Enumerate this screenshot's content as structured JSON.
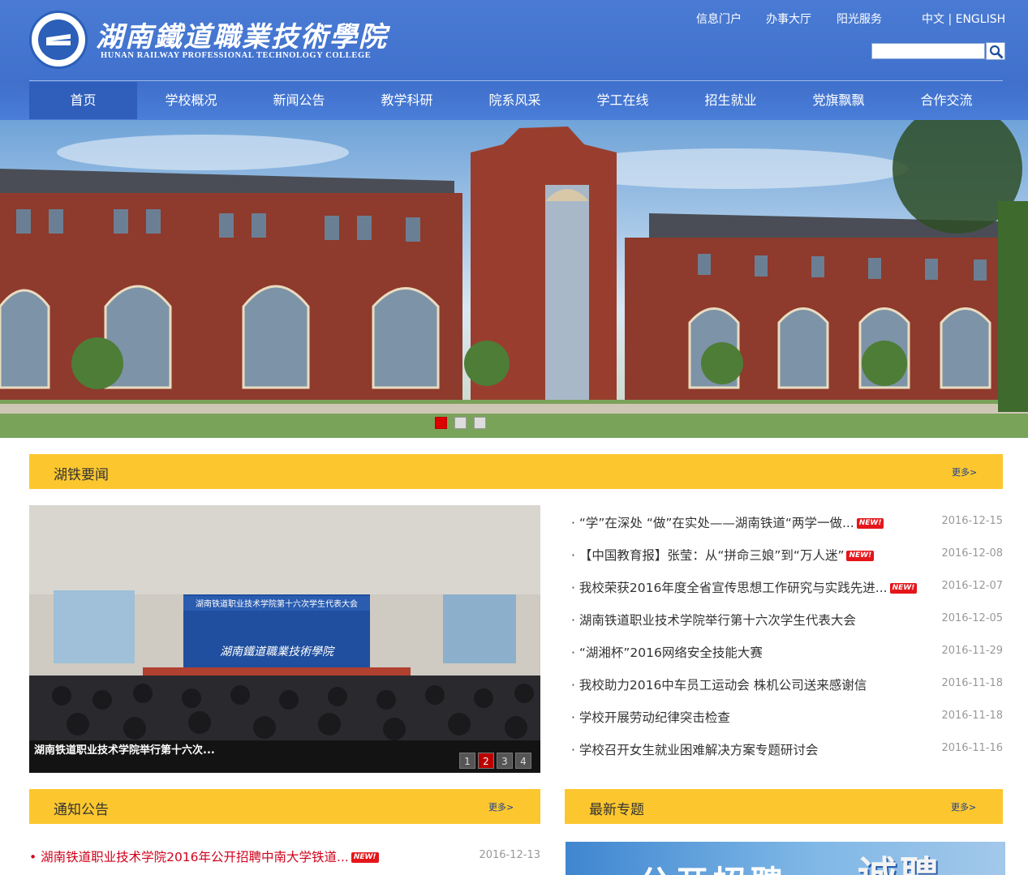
{
  "brand": {
    "name_cn": "湖南鐵道職業技術學院",
    "name_en": "HUNAN RAILWAY PROFESSIONAL TECHNOLOGY COLLEGE"
  },
  "toplinks": {
    "portal": "信息门户",
    "hall": "办事大厅",
    "sunshine": "阳光服务",
    "lang": "中文 | ENGLISH"
  },
  "search": {
    "placeholder": ""
  },
  "nav": [
    "首页",
    "学校概况",
    "新闻公告",
    "教学科研",
    "院系风采",
    "学工在线",
    "招生就业",
    "党旗飘飘",
    "合作交流"
  ],
  "news_section": {
    "title": "湖铁要闻",
    "more": "更多>"
  },
  "photo": {
    "caption": "湖南铁道职业技术学院举行第十六次...",
    "banner_text": "湖南铁道职业技术学院第十六次学生代表大会",
    "wall_text": "湖南鐵道職業技術學院",
    "pages": [
      "1",
      "2",
      "3",
      "4"
    ]
  },
  "news": [
    {
      "title": "“学”在深处 “做”在实处——湖南铁道“两学一做...",
      "date": "2016-12-15",
      "new": "NEW!"
    },
    {
      "title": "【中国教育报】张莹：从“拼命三娘”到“万人迷”",
      "date": "2016-12-08",
      "new": "NEW!"
    },
    {
      "title": "我校荣获2016年度全省宣传思想工作研究与实践先进...",
      "date": "2016-12-07",
      "new": "NEW!"
    },
    {
      "title": "湖南铁道职业技术学院举行第十六次学生代表大会",
      "date": "2016-12-05",
      "new": ""
    },
    {
      "title": "“湖湘杯”2016网络安全技能大赛",
      "date": "2016-11-29",
      "new": ""
    },
    {
      "title": "我校助力2016中车员工运动会 株机公司送来感谢信",
      "date": "2016-11-18",
      "new": ""
    },
    {
      "title": "学校开展劳动纪律突击检查",
      "date": "2016-11-18",
      "new": ""
    },
    {
      "title": "学校召开女生就业困难解决方案专题研讨会",
      "date": "2016-11-16",
      "new": ""
    }
  ],
  "notice_section": {
    "title": "通知公告",
    "more": "更多>"
  },
  "notice": {
    "title": "湖南铁道职业技术学院2016年公开招聘中南大学铁道...",
    "date": "2016-12-13",
    "new": "NEW!"
  },
  "special_section": {
    "title": "最新专题",
    "more": "更多>"
  },
  "special_banner": {
    "text_a": "公开招聘",
    "text_b": "诚聘"
  }
}
